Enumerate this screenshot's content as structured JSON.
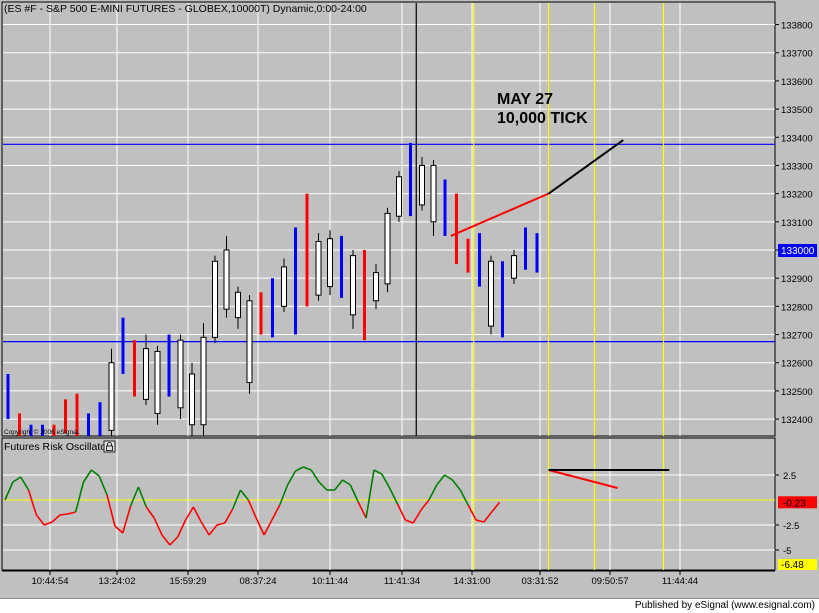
{
  "header": {
    "symbol_title": "(ES #F - S&P 500 E-MINI FUTURES - GLOBEX,10000T) Dynamic,0:00-24:00",
    "annotation_line1": "MAY 27",
    "annotation_line2": "10,000 TICK",
    "copyright": "Copyright © 2006 eSignal."
  },
  "oscillator": {
    "title": "Futures Risk Oscillator",
    "lock_icon": "lock-icon"
  },
  "footer": {
    "published": "Published by eSignal (www.esignal.com)"
  },
  "colors": {
    "panel_bg": "#c0c0c0",
    "grid": "#ffffff",
    "up_bar": "#0000ff",
    "down_bar": "#ff0000",
    "candle_body": "#ffffff",
    "hline_blue": "#0000ff",
    "vline_yellow": "#ffff00",
    "osc_green": "#008000",
    "osc_red": "#ff0000",
    "zero_line": "#ffff00",
    "last_price_bg": "#0000ff",
    "osc_last_bg": "#ff0000",
    "osc_min_bg": "#ffff00"
  },
  "chart_data": [
    {
      "type": "candlestick",
      "title": "(ES #F - S&P 500 E-MINI FUTURES - GLOBEX,10000T) Dynamic,0:00-24:00",
      "ylim": [
        132340,
        133880
      ],
      "y_ticks": [
        133800,
        133700,
        133600,
        133500,
        133400,
        133300,
        133200,
        133100,
        133000,
        132900,
        132800,
        132700,
        132600,
        132500,
        132400
      ],
      "y_tick_labels": [
        "133800",
        "133700",
        "133600",
        "133500",
        "133400",
        "133300",
        "133200",
        "133100",
        "133000",
        "132900",
        "132800",
        "132700",
        "132600",
        "132500",
        "132400"
      ],
      "last_price": "133000",
      "last_price_value": 133000,
      "horizontal_lines": [
        133375,
        132675
      ],
      "x_labels": [
        "10:44:54",
        "13:24:02",
        "15:59:29",
        "08:37:24",
        "10:11:44",
        "11:41:34",
        "14:31:00",
        "03:31:52",
        "09:50:57",
        "11:44:44"
      ],
      "bars": [
        {
          "h": 132560,
          "l": 132400,
          "c": "u"
        },
        {
          "h": 132420,
          "l": 132340,
          "c": "d"
        },
        {
          "h": 132380,
          "l": 132340,
          "c": "u"
        },
        {
          "h": 132380,
          "l": 132340,
          "c": "u"
        },
        {
          "h": 132380,
          "l": 132340,
          "c": "d"
        },
        {
          "h": 132470,
          "l": 132350,
          "c": "d"
        },
        {
          "h": 132490,
          "l": 132340,
          "c": "d"
        },
        {
          "h": 132420,
          "l": 132340,
          "c": "u"
        },
        {
          "h": 132460,
          "l": 132340,
          "c": "u"
        },
        {
          "h": 132650,
          "l": 132340,
          "o": 132360,
          "cl": 132600
        },
        {
          "h": 132760,
          "l": 132560,
          "c": "u"
        },
        {
          "h": 132680,
          "l": 132480,
          "c": "d"
        },
        {
          "h": 132700,
          "l": 132450,
          "o": 132470,
          "cl": 132650
        },
        {
          "h": 132660,
          "l": 132380,
          "o": 132640,
          "cl": 132420
        },
        {
          "h": 132700,
          "l": 132480,
          "c": "u"
        },
        {
          "h": 132700,
          "l": 132400,
          "o": 132680,
          "cl": 132440
        },
        {
          "h": 132600,
          "l": 132340,
          "o": 132560,
          "cl": 132380
        },
        {
          "h": 132740,
          "l": 132340,
          "o": 132380,
          "cl": 132690
        },
        {
          "h": 132980,
          "l": 132670,
          "o": 132690,
          "cl": 132960
        },
        {
          "h": 133050,
          "l": 132760,
          "o": 133000,
          "cl": 132790
        },
        {
          "h": 132870,
          "l": 132720,
          "o": 132850,
          "cl": 132760
        },
        {
          "h": 132840,
          "l": 132490,
          "o": 132820,
          "cl": 132530
        },
        {
          "h": 132850,
          "l": 132700,
          "c": "d"
        },
        {
          "h": 132900,
          "l": 132690,
          "c": "u"
        },
        {
          "h": 132970,
          "l": 132780,
          "o": 132800,
          "cl": 132940
        },
        {
          "h": 133080,
          "l": 132700,
          "c": "u"
        },
        {
          "h": 133200,
          "l": 132800,
          "c": "d"
        },
        {
          "h": 133060,
          "l": 132820,
          "o": 132840,
          "cl": 133030
        },
        {
          "h": 133070,
          "l": 132840,
          "o": 133040,
          "cl": 132870
        },
        {
          "h": 133050,
          "l": 132830,
          "c": "u"
        },
        {
          "h": 133000,
          "l": 132720,
          "o": 132980,
          "cl": 132770
        },
        {
          "h": 133000,
          "l": 132680,
          "c": "d"
        },
        {
          "h": 132950,
          "l": 132790,
          "o": 132820,
          "cl": 132920
        },
        {
          "h": 133150,
          "l": 132850,
          "o": 132880,
          "cl": 133130
        },
        {
          "h": 133280,
          "l": 133100,
          "o": 133120,
          "cl": 133260
        },
        {
          "h": 133380,
          "l": 133120,
          "c": "u"
        },
        {
          "h": 133330,
          "l": 133140,
          "o": 133160,
          "cl": 133300
        },
        {
          "h": 133320,
          "l": 133050,
          "o": 133300,
          "cl": 133100
        },
        {
          "h": 133250,
          "l": 133050,
          "c": "u"
        },
        {
          "h": 133200,
          "l": 132950,
          "c": "d"
        },
        {
          "h": 133040,
          "l": 132920,
          "c": "d"
        },
        {
          "h": 133060,
          "l": 132870,
          "c": "u"
        },
        {
          "h": 132980,
          "l": 132700,
          "o": 132960,
          "cl": 132730
        },
        {
          "h": 132960,
          "l": 132690,
          "c": "u"
        },
        {
          "h": 133000,
          "l": 132880,
          "o": 132900,
          "cl": 132980
        },
        {
          "h": 133080,
          "l": 132930,
          "c": "u"
        },
        {
          "h": 133060,
          "l": 132920,
          "c": "u"
        }
      ],
      "trendlines": [
        {
          "color": "#ff0000",
          "points": [
            [
              38.5,
              133050
            ],
            [
              47,
              133200
            ]
          ]
        },
        {
          "color": "#000000",
          "points": [
            [
              47,
              133200
            ],
            [
              53.5,
              133390
            ]
          ]
        }
      ],
      "vertical_lines": [
        {
          "color": "#000000",
          "at": 35.5
        },
        {
          "color": "#ffff00",
          "at": 40.5
        },
        {
          "color": "#ffff00",
          "at": 47
        },
        {
          "color": "#ffff00",
          "at": 51
        },
        {
          "color": "#ffff00",
          "at": 57
        }
      ]
    },
    {
      "type": "line",
      "title": "Futures Risk Oscillator",
      "ylim": [
        -7,
        4.8
      ],
      "y_ticks": [
        2.5,
        -2.5,
        -5
      ],
      "y_tick_labels": [
        "2.5",
        "-2.5",
        "-5"
      ],
      "last_value": "-0.23",
      "min_label": "-6.48",
      "series": [
        {
          "values": [
            0.0,
            1.8,
            2.3,
            1.0,
            -1.5,
            -2.5,
            -2.2,
            -1.5,
            -1.4,
            -1.2,
            1.8,
            3.0,
            2.4,
            0.5,
            -2.6,
            -3.3,
            -0.6,
            1.3,
            -0.7,
            -1.8,
            -3.5,
            -4.5,
            -3.7,
            -2.0,
            -0.7,
            -2.2,
            -3.5,
            -2.5,
            -2.3,
            -0.9,
            1.0,
            0.0,
            -1.8,
            -3.5,
            -2.0,
            -0.5,
            1.5,
            2.9,
            3.3,
            3.0,
            1.8,
            1.0,
            1.0,
            2.0,
            1.5,
            -0.2,
            -1.8,
            3.0,
            2.6,
            1.2,
            -0.4,
            -2.0,
            -2.3,
            -1.0,
            0.0,
            1.5,
            2.5,
            2.0,
            1.0,
            -0.5,
            -2.0,
            -2.2,
            -1.2,
            -0.23
          ]
        }
      ],
      "trendlines": [
        {
          "color": "#ff0000",
          "points": [
            [
              47,
              3.0
            ],
            [
              53,
              1.2
            ]
          ]
        },
        {
          "color": "#000000",
          "points": [
            [
              47,
              3.0
            ],
            [
              57.5,
              3.0
            ]
          ]
        }
      ]
    }
  ]
}
